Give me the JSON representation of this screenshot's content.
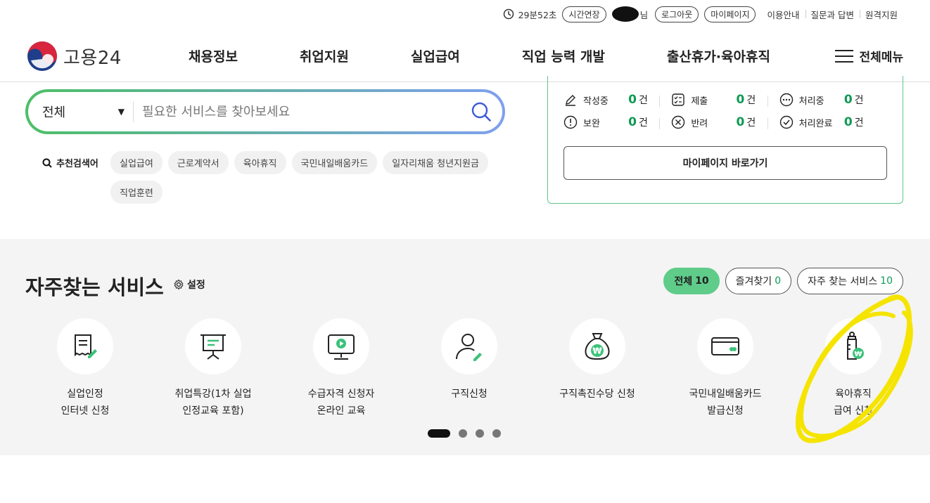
{
  "utility": {
    "timer": "29분52초",
    "extend": "시간연장",
    "user_suffix": "님",
    "logout": "로그아웃",
    "mypage": "마이페이지",
    "links": [
      "이용안내",
      "질문과 답변",
      "원격지원"
    ]
  },
  "header": {
    "logo_text": "고용24",
    "nav": [
      "채용정보",
      "취업지원",
      "실업급여",
      "직업 능력 개발",
      "출산휴가·육아휴직"
    ],
    "all_menu": "전체메뉴"
  },
  "search": {
    "category": "전체",
    "placeholder": "필요한 서비스를 찾아보세요",
    "recommended_label": "추천검색어",
    "recommended": [
      "실업급여",
      "근로계약서",
      "육아휴직",
      "국민내일배움카드",
      "일자리채움 청년지원금",
      "직업훈련"
    ]
  },
  "status": {
    "rows": [
      [
        {
          "icon": "pencil-icon",
          "label": "작성중",
          "count": "0",
          "unit": "건"
        },
        {
          "icon": "checklist-icon",
          "label": "제출",
          "count": "0",
          "unit": "건"
        },
        {
          "icon": "more-circle-icon",
          "label": "처리중",
          "count": "0",
          "unit": "건"
        }
      ],
      [
        {
          "icon": "exclamation-circle-icon",
          "label": "보완",
          "count": "0",
          "unit": "건"
        },
        {
          "icon": "x-circle-icon",
          "label": "반려",
          "count": "0",
          "unit": "건"
        },
        {
          "icon": "check-circle-icon",
          "label": "처리완료",
          "count": "0",
          "unit": "건"
        }
      ]
    ],
    "mypage_button": "마이페이지 바로가기"
  },
  "frequent": {
    "title": "자주찾는 서비스",
    "settings": "설정",
    "tabs": [
      {
        "label": "전체",
        "count": "10"
      },
      {
        "label": "즐겨찾기",
        "count": "0"
      },
      {
        "label": "자주 찾는 서비스",
        "count": "10"
      }
    ],
    "services": [
      {
        "label": "실업인정\n인터넷 신청",
        "icon": "document-edit-icon"
      },
      {
        "label": "취업특강(1차 실업\n인정교육 포함)",
        "icon": "presentation-board-icon"
      },
      {
        "label": "수급자격 신청자\n온라인 교육",
        "icon": "monitor-play-icon"
      },
      {
        "label": "구직신청",
        "icon": "person-edit-icon"
      },
      {
        "label": "구직촉진수당 신청",
        "icon": "money-bag-icon"
      },
      {
        "label": "국민내일배움카드\n발급신청",
        "icon": "card-icon"
      },
      {
        "label": "육아휴직\n급여 신청",
        "icon": "baby-bottle-icon"
      }
    ],
    "pages": 4,
    "active_page": 0
  },
  "colors": {
    "accent_green": "#0f9a55",
    "tab_active": "#5fcc8a",
    "annotation_yellow": "#f5e400"
  }
}
